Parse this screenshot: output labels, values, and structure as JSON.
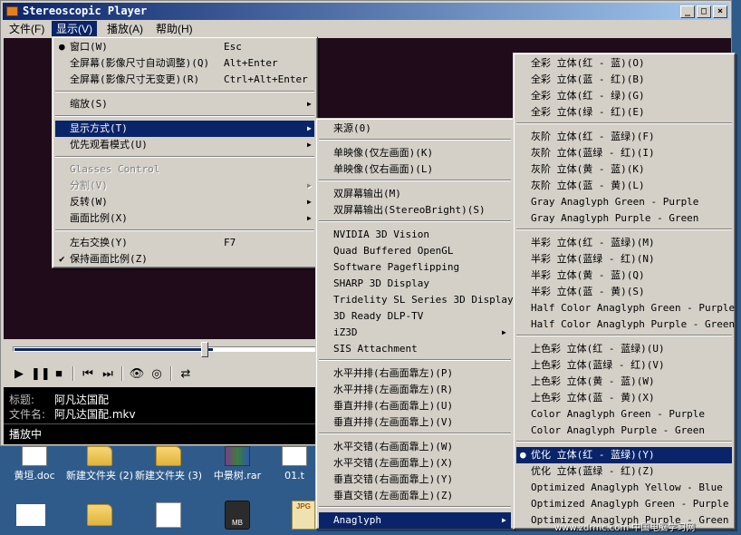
{
  "window": {
    "title": "Stereoscopic Player"
  },
  "menubar": [
    {
      "label": "文件(F)"
    },
    {
      "label": "显示(V)"
    },
    {
      "label": "播放(A)"
    },
    {
      "label": "帮助(H)"
    }
  ],
  "view_menu": [
    {
      "label": "窗口(W)",
      "shortcut": "Esc",
      "checked": true
    },
    {
      "label": "全屏幕(影像尺寸自动调整)(Q)",
      "shortcut": "Alt+Enter"
    },
    {
      "label": "全屏幕(影像尺寸无变更)(R)",
      "shortcut": "Ctrl+Alt+Enter"
    },
    {
      "label": "缩放(S)",
      "submenu": true
    },
    {
      "label": "显示方式(T)",
      "submenu": true
    },
    {
      "label": "优先观看模式(U)",
      "submenu": true
    },
    {
      "label": "Glasses Control",
      "disabled": true
    },
    {
      "label": "分割(V)",
      "disabled": true,
      "submenu": true
    },
    {
      "label": "反转(W)",
      "submenu": true
    },
    {
      "label": "画面比例(X)",
      "submenu": true
    },
    {
      "label": "左右交换(Y)",
      "shortcut": "F7"
    },
    {
      "label": "保持画面比例(Z)",
      "checked": true
    }
  ],
  "display_menu": [
    {
      "label": "来源(0)"
    },
    {
      "label": "单映像(仅左画面)(K)"
    },
    {
      "label": "单映像(仅右画面)(L)"
    },
    {
      "label": "双屏幕输出(M)"
    },
    {
      "label": "双屏幕输出(StereoBright)(S)"
    },
    {
      "label": "NVIDIA 3D Vision"
    },
    {
      "label": "Quad Buffered OpenGL"
    },
    {
      "label": "Software Pageflipping"
    },
    {
      "label": "SHARP 3D Display"
    },
    {
      "label": "Tridelity SL Series 3D Display"
    },
    {
      "label": "3D Ready DLP-TV"
    },
    {
      "label": "iZ3D"
    },
    {
      "label": "SIS Attachment"
    },
    {
      "label": "水平并排(右画面靠左)(P)"
    },
    {
      "label": "水平并排(左画面靠左)(R)"
    },
    {
      "label": "垂直并排(右画面靠上)(U)"
    },
    {
      "label": "垂直并排(左画面靠上)(V)"
    },
    {
      "label": "水平交错(右画面靠上)(W)"
    },
    {
      "label": "水平交错(左画面靠上)(X)"
    },
    {
      "label": "垂直交错(右画面靠上)(Y)"
    },
    {
      "label": "垂直交错(左画面靠上)(Z)"
    },
    {
      "label": "Anaglyph"
    }
  ],
  "anaglyph_menu": [
    {
      "label": "全彩 立体(红 - 蓝)(O)"
    },
    {
      "label": "全彩 立体(蓝 - 红)(B)"
    },
    {
      "label": "全彩 立体(红 - 绿)(G)"
    },
    {
      "label": "全彩 立体(绿 - 红)(E)"
    },
    {
      "label": "灰阶 立体(红 - 蓝绿)(F)"
    },
    {
      "label": "灰阶 立体(蓝绿 - 红)(I)"
    },
    {
      "label": "灰阶 立体(黄 - 蓝)(K)"
    },
    {
      "label": "灰阶 立体(蓝 - 黄)(L)"
    },
    {
      "label": "Gray Anaglyph Green - Purple"
    },
    {
      "label": "Gray Anaglyph Purple - Green"
    },
    {
      "label": "半彩 立体(红 - 蓝绿)(M)"
    },
    {
      "label": "半彩 立体(蓝绿 - 红)(N)"
    },
    {
      "label": "半彩 立体(黄 - 蓝)(Q)"
    },
    {
      "label": "半彩 立体(蓝 - 黄)(S)"
    },
    {
      "label": "Half Color Anaglyph Green - Purple"
    },
    {
      "label": "Half Color Anaglyph Purple - Green"
    },
    {
      "label": "上色彩 立体(红 - 蓝绿)(U)"
    },
    {
      "label": "上色彩 立体(蓝绿 - 红)(V)"
    },
    {
      "label": "上色彩 立体(黄 - 蓝)(W)"
    },
    {
      "label": "上色彩 立体(蓝 - 黄)(X)"
    },
    {
      "label": "Color Anaglyph Green - Purple"
    },
    {
      "label": "Color Anaglyph Purple - Green"
    },
    {
      "label": "优化 立体(红 - 蓝绿)(Y)",
      "checked": true
    },
    {
      "label": "优化 立体(蓝绿 - 红)(Z)"
    },
    {
      "label": "Optimized Anaglyph Yellow - Blue"
    },
    {
      "label": "Optimized Anaglyph Green - Purple"
    },
    {
      "label": "Optimized Anaglyph Purple - Green"
    }
  ],
  "info": {
    "title_label": "标题:",
    "title_value": "阿凡达国配",
    "file_label": "文件名:",
    "file_value": "阿凡达国配.mkv"
  },
  "status": "播放中",
  "seek_progress": 0.28,
  "desktop_icons": [
    {
      "label": "黄垣.doc"
    },
    {
      "label": "新建文件夹 (2)"
    },
    {
      "label": "新建文件夹 (3)"
    },
    {
      "label": "中景树.rar"
    },
    {
      "label": "01.t"
    }
  ],
  "desktop_badges": {
    "mb": "MB",
    "jpg": "JPG"
  },
  "watermark": "www.zdrmc.com 中国电脑学习网"
}
